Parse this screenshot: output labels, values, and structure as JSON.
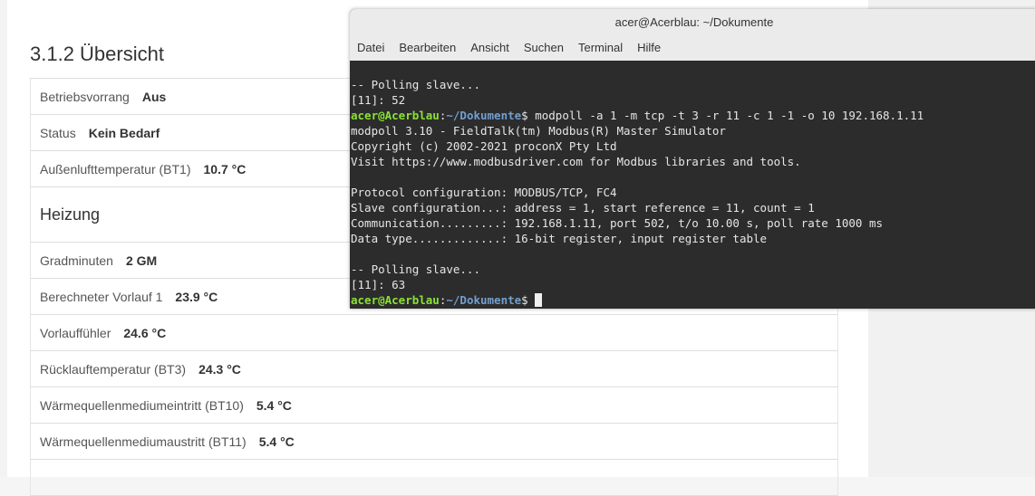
{
  "web": {
    "section_title": "3.1.2 Übersicht",
    "rows": [
      {
        "label": "Betriebsvorrang",
        "value": "Aus"
      },
      {
        "label": "Status",
        "value": "Kein Bedarf"
      },
      {
        "label": "Außenlufttemperatur (BT1)",
        "value": "10.7 °C"
      }
    ],
    "heading": "Heizung",
    "heating_rows": [
      {
        "label": "Gradminuten",
        "value": "2 GM"
      },
      {
        "label": "Berechneter Vorlauf 1",
        "value": "23.9 °C"
      },
      {
        "label": "Vorlauffühler",
        "value": "24.6 °C"
      },
      {
        "label": "Rücklauftemperatur (BT3)",
        "value": "24.3 °C"
      },
      {
        "label": "Wärmequellenmediumeintritt (BT10)",
        "value": "5.4 °C"
      },
      {
        "label": "Wärmequellenmediumaustritt (BT11)",
        "value": "5.4 °C"
      }
    ]
  },
  "terminal": {
    "title": "acer@Acerblau: ~/Dokumente",
    "menu": [
      "Datei",
      "Bearbeiten",
      "Ansicht",
      "Suchen",
      "Terminal",
      "Hilfe"
    ],
    "prompt_user": "acer@Acerblau",
    "prompt_sep": ":",
    "prompt_path": "~/Dokumente",
    "prompt_end": "$",
    "lines": {
      "l1": "-- Polling slave...",
      "l2": "[11]: 52",
      "cmd": " modpoll -a 1 -m tcp -t 3 -r 11 -c 1 -1 -o 10 192.168.1.11",
      "l4": "modpoll 3.10 - FieldTalk(tm) Modbus(R) Master Simulator",
      "l5": "Copyright (c) 2002-2021 proconX Pty Ltd",
      "l6": "Visit https://www.modbusdriver.com for Modbus libraries and tools.",
      "l8": "Protocol configuration: MODBUS/TCP, FC4",
      "l9": "Slave configuration...: address = 1, start reference = 11, count = 1",
      "l10": "Communication.........: 192.168.1.11, port 502, t/o 10.00 s, poll rate 1000 ms",
      "l11": "Data type.............: 16-bit register, input register table",
      "l13": "-- Polling slave...",
      "l14": "[11]: 63"
    }
  }
}
